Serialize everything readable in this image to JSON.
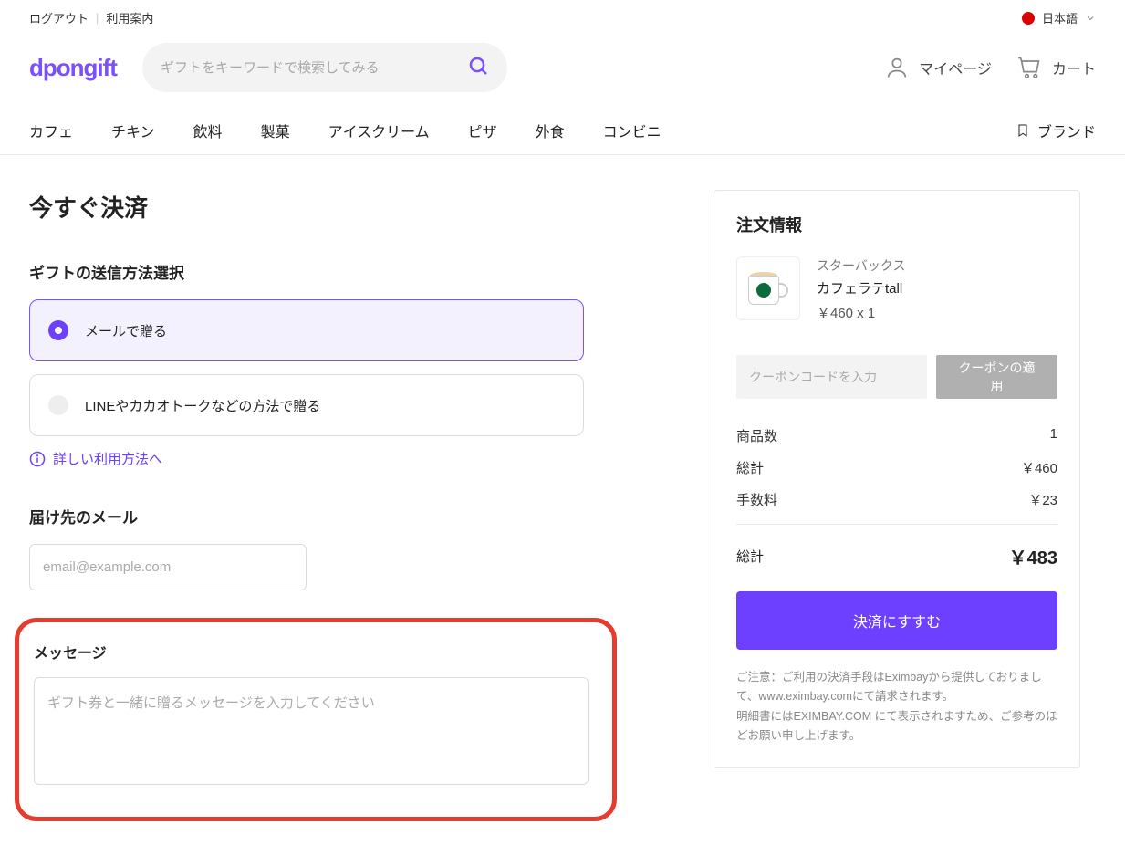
{
  "topbar": {
    "logout": "ログアウト",
    "guide": "利用案内"
  },
  "lang": {
    "label": "日本語"
  },
  "logo": {
    "d": "dpon",
    "gift": "gift"
  },
  "search": {
    "placeholder": "ギフトをキーワードで検索してみる"
  },
  "header": {
    "mypage": "マイページ",
    "cart": "カート"
  },
  "nav": [
    "カフェ",
    "チキン",
    "飲料",
    "製菓",
    "アイスクリーム",
    "ピザ",
    "外食",
    "コンビニ"
  ],
  "nav_brand": "ブランド",
  "page_title": "今すぐ決済",
  "send_method": {
    "label": "ギフトの送信方法選択",
    "option_email": "メールで贈る",
    "option_sns": "LINEやカカオトークなどの方法で贈る",
    "help": "詳しい利用方法へ"
  },
  "email": {
    "label": "届け先のメール",
    "placeholder": "email@example.com"
  },
  "message": {
    "label": "メッセージ",
    "placeholder": "ギフト券と一緒に贈るメッセージを入力してください"
  },
  "order": {
    "title": "注文情報",
    "brand": "スターバックス",
    "product": "カフェラテtall",
    "unit_price": "￥460 x 1",
    "coupon_placeholder": "クーポンコードを入力",
    "coupon_btn": "クーポンの適用",
    "qty_label": "商品数",
    "qty_val": "1",
    "subtotal_label": "総計",
    "subtotal_val": "￥460",
    "fee_label": "手数料",
    "fee_val": "￥23",
    "total_label": "総計",
    "total_val": "￥483",
    "checkout": "決済にすすむ",
    "disclaimer1": "ご注意：ご利用の決済手段はEximbayから提供しておりまして、www.eximbay.comにて請求されます。",
    "disclaimer2": "明細書にはEXIMBAY.COM にて表示されますため、ご参考のほどお願い申し上げます。"
  }
}
